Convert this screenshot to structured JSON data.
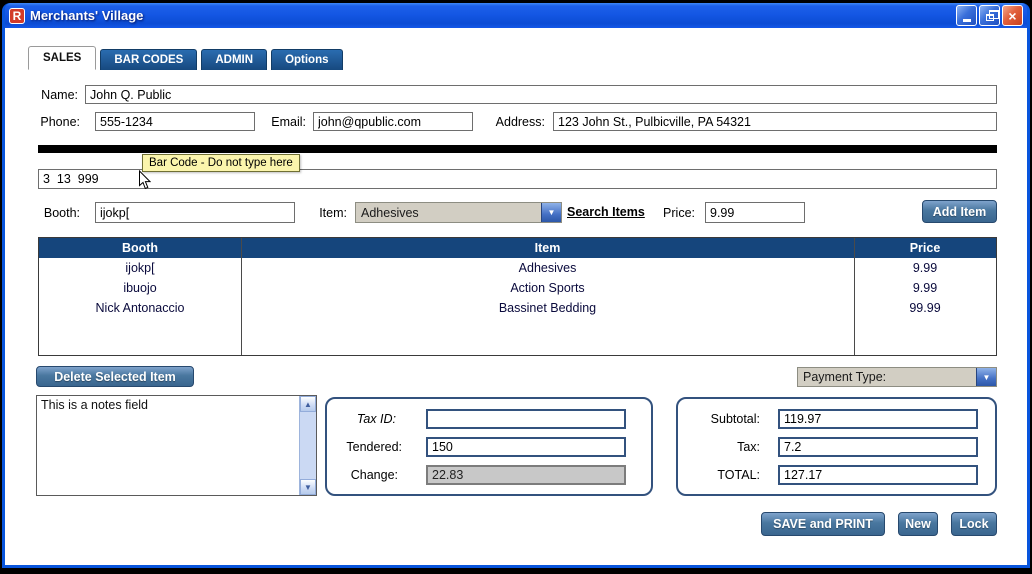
{
  "window": {
    "title": "Merchants' Village",
    "logo_letter": "R"
  },
  "tabs": [
    {
      "label": "SALES",
      "active": true
    },
    {
      "label": "BAR CODES",
      "active": false
    },
    {
      "label": "ADMIN",
      "active": false
    },
    {
      "label": "Options",
      "active": false
    }
  ],
  "customer": {
    "name_label": "Name:",
    "name_value": "John Q. Public",
    "phone_label": "Phone:",
    "phone_value": "555-1234",
    "email_label": "Email:",
    "email_value": "john@qpublic.com",
    "address_label": "Address:",
    "address_value": "123 John St., Pulbicville, PA 54321"
  },
  "barcode": {
    "tooltip": "Bar Code - Do not type here",
    "value": "3  13  999"
  },
  "item_entry": {
    "booth_label": "Booth:",
    "booth_value": "ijokp[",
    "item_label": "Item:",
    "item_selected": "Adhesives",
    "search_items_label": "Search Items",
    "price_label": "Price:",
    "price_value": "9.99",
    "add_item_label": "Add Item"
  },
  "items_table": {
    "headers": {
      "booth": "Booth",
      "item": "Item",
      "price": "Price"
    },
    "rows": [
      {
        "booth": "ijokp[",
        "item": "Adhesives",
        "price": "9.99"
      },
      {
        "booth": "ibuojo",
        "item": "Action Sports",
        "price": "9.99"
      },
      {
        "booth": "Nick Antonaccio",
        "item": "Bassinet Bedding",
        "price": "99.99"
      }
    ]
  },
  "toolbar": {
    "delete_selected_label": "Delete Selected Item",
    "payment_type_label": "Payment Type:"
  },
  "notes": {
    "value": "This is a notes field"
  },
  "payment": {
    "tax_id_label": "Tax ID:",
    "tax_id_value": "",
    "tendered_label": "Tendered:",
    "tendered_value": "150",
    "change_label": "Change:",
    "change_value": "22.83"
  },
  "totals": {
    "subtotal_label": "Subtotal:",
    "subtotal_value": "119.97",
    "tax_label": "Tax:",
    "tax_value": "7.2",
    "total_label": "TOTAL:",
    "total_value": "127.17"
  },
  "footer_buttons": {
    "save_print_label": "SAVE and PRINT",
    "new_label": "New",
    "lock_label": "Lock"
  },
  "colors": {
    "titlebar_blue": "#1457E4",
    "window_frame": "#0855DD",
    "tab_inactive_blue": "#1C5C9E",
    "table_header_navy": "#15457C",
    "button_blue": "#49779F",
    "tooltip_yellow": "#FBF5AC",
    "panel_border_navy": "#33527E",
    "combo_gray": "#D2CEC3"
  }
}
